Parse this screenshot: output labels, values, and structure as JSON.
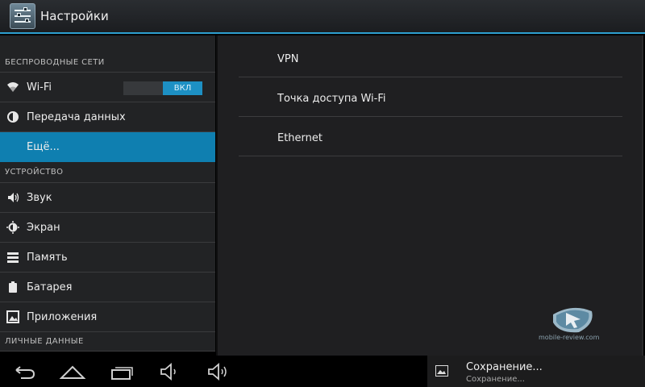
{
  "header": {
    "title": "Настройки",
    "icon": "settings-sliders-icon"
  },
  "sidebar": {
    "sections": [
      {
        "title": "БЕСПРОВОДНЫЕ СЕТИ"
      },
      {
        "title": "УСТРОЙСТВО"
      },
      {
        "title": "ЛИЧНЫЕ ДАННЫЕ"
      }
    ],
    "items": [
      {
        "label": "Wi-Fi",
        "icon": "wifi-icon",
        "toggle": "ВКЛ"
      },
      {
        "label": "Передача данных",
        "icon": "data-usage-icon"
      },
      {
        "label": "Ещё...",
        "selected": true
      },
      {
        "label": "Звук",
        "icon": "speaker-icon"
      },
      {
        "label": "Экран",
        "icon": "display-icon"
      },
      {
        "label": "Память",
        "icon": "storage-icon"
      },
      {
        "label": "Батарея",
        "icon": "battery-icon"
      },
      {
        "label": "Приложения",
        "icon": "apps-icon"
      }
    ]
  },
  "content": {
    "items": [
      {
        "label": "VPN"
      },
      {
        "label": "Точка доступа Wi-Fi"
      },
      {
        "label": "Ethernet"
      }
    ]
  },
  "watermark": {
    "text": "mobile-review.com"
  },
  "navbar": {
    "buttons": [
      "back-icon",
      "home-icon",
      "recent-apps-icon",
      "volume-down-icon",
      "volume-up-icon"
    ]
  },
  "notification": {
    "title": "Сохранение...",
    "subtitle": "Сохранение...",
    "icon": "image-icon"
  },
  "colors": {
    "accent": "#0f7fb0",
    "background": "#1f1f21",
    "sidebar": "#222325"
  }
}
